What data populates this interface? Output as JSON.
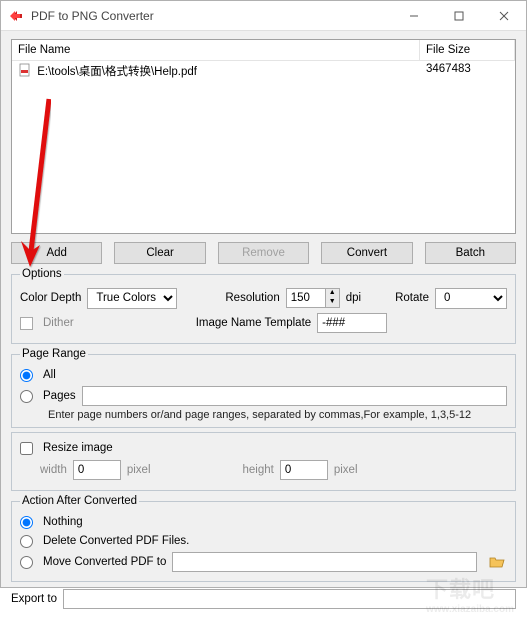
{
  "window": {
    "title": "PDF to PNG Converter"
  },
  "table": {
    "col_name": "File Name",
    "col_size": "File Size",
    "rows": [
      {
        "name": "E:\\tools\\桌面\\格式转换\\Help.pdf",
        "size": "3467483"
      }
    ]
  },
  "buttons": {
    "add": "Add",
    "clear": "Clear",
    "remove": "Remove",
    "convert": "Convert",
    "batch": "Batch"
  },
  "options": {
    "legend": "Options",
    "color_depth_label": "Color Depth",
    "color_depth_value": "True Colors",
    "dither_label": "Dither",
    "resolution_label": "Resolution",
    "resolution_value": "150",
    "resolution_unit": "dpi",
    "rotate_label": "Rotate",
    "rotate_value": "0",
    "image_name_template_label": "Image Name Template",
    "image_name_template_value": "-###"
  },
  "page_range": {
    "legend": "Page Range",
    "all_label": "All",
    "pages_label": "Pages",
    "pages_value": "",
    "hint": "Enter page numbers or/and page ranges, separated by commas,For example, 1,3,5-12"
  },
  "resize": {
    "checkbox_label": "Resize image",
    "width_label": "width",
    "width_value": "0",
    "height_label": "height",
    "height_value": "0",
    "unit": "pixel"
  },
  "action": {
    "legend": "Action After Converted",
    "nothing": "Nothing",
    "delete": "Delete Converted PDF Files.",
    "move": "Move Converted PDF to",
    "move_path": ""
  },
  "export": {
    "label": "Export to",
    "value": ""
  },
  "watermark": {
    "main": "下载吧",
    "sub": "www.xiazaiba.com"
  }
}
